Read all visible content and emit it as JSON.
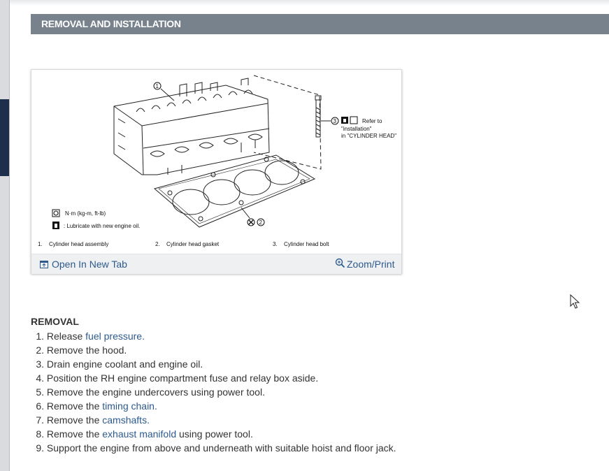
{
  "section": {
    "title": "REMOVAL AND INSTALLATION"
  },
  "figure": {
    "torque_note": "Refer to",
    "torque_note_2": "\"installation\"",
    "torque_note_3": "in \"CYLINDER HEAD\"",
    "legend_torque": "N·m (kg-m, ft-lb)",
    "legend_oil": ": Lubricate with new engine oil.",
    "callouts": [
      {
        "num": "1.",
        "label": "Cylinder head assembly"
      },
      {
        "num": "2.",
        "label": "Cylinder head gasket"
      },
      {
        "num": "3.",
        "label": "Cylinder head bolt"
      }
    ],
    "open_tab_label": "Open In New Tab",
    "zoom_label": "Zoom/Print",
    "markers": [
      "1",
      "2",
      "3"
    ]
  },
  "removal": {
    "title": "REMOVAL",
    "steps": [
      {
        "num": "1.",
        "pre": "Release ",
        "link": "fuel pressure.",
        "post": ""
      },
      {
        "num": "2.",
        "pre": "Remove the hood.",
        "link": "",
        "post": ""
      },
      {
        "num": "3.",
        "pre": "Drain engine coolant and engine oil.",
        "link": "",
        "post": ""
      },
      {
        "num": "4.",
        "pre": "Position the RH engine compartment fuse and relay box aside.",
        "link": "",
        "post": ""
      },
      {
        "num": "5.",
        "pre": "Remove the engine undercovers using power tool.",
        "link": "",
        "post": ""
      },
      {
        "num": "6.",
        "pre": "Remove the ",
        "link": "timing chain.",
        "post": ""
      },
      {
        "num": "7.",
        "pre": "Remove the ",
        "link": "camshafts.",
        "post": ""
      },
      {
        "num": "8.",
        "pre": "Remove the ",
        "link": "exhaust manifold",
        "post": " using power tool."
      },
      {
        "num": "9.",
        "pre": "Support the engine from above and underneath with suitable hoist and floor jack.",
        "link": "",
        "post": ""
      }
    ]
  },
  "colors": {
    "header_bg": "#77828d",
    "link": "#2d5a8e",
    "toolbar_bg": "#eef0f2"
  }
}
